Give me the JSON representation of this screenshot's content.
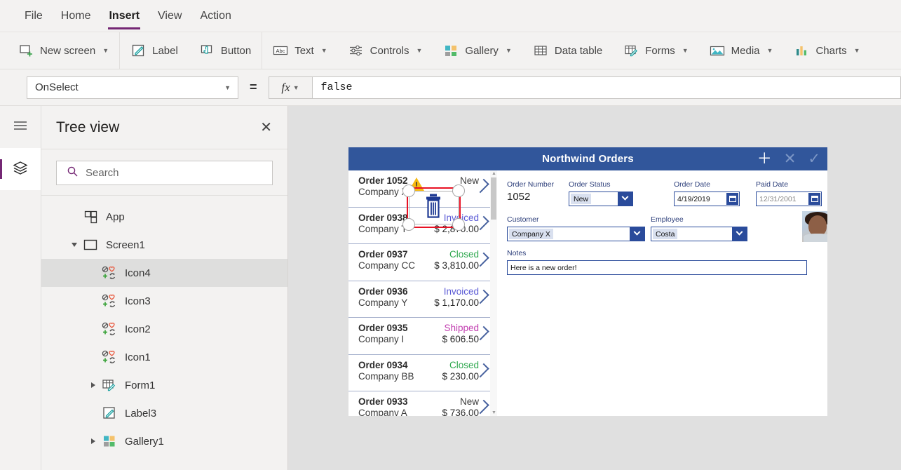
{
  "menubar": {
    "items": [
      {
        "label": "File",
        "active": false
      },
      {
        "label": "Home",
        "active": false
      },
      {
        "label": "Insert",
        "active": true
      },
      {
        "label": "View",
        "active": false
      },
      {
        "label": "Action",
        "active": false
      }
    ]
  },
  "ribbon": {
    "items": [
      {
        "label": "New screen",
        "icon": "new-screen-icon",
        "caret": true
      },
      {
        "label": "Label",
        "icon": "label-icon",
        "caret": false
      },
      {
        "label": "Button",
        "icon": "button-icon",
        "caret": false
      },
      {
        "label": "Text",
        "icon": "text-abc-icon",
        "caret": true
      },
      {
        "label": "Controls",
        "icon": "controls-sliders-icon",
        "caret": true
      },
      {
        "label": "Gallery",
        "icon": "gallery-squares-icon",
        "caret": true
      },
      {
        "label": "Data table",
        "icon": "data-table-icon",
        "caret": false
      },
      {
        "label": "Forms",
        "icon": "forms-icon",
        "caret": true
      },
      {
        "label": "Media",
        "icon": "media-image-icon",
        "caret": true
      },
      {
        "label": "Charts",
        "icon": "charts-bar-icon",
        "caret": true
      }
    ]
  },
  "formula_bar": {
    "property": "OnSelect",
    "equals": "=",
    "fx_label": "fx",
    "value": "false"
  },
  "rail": {
    "menu_icon": "hamburger-menu-icon",
    "tree_icon": "layers-tree-icon",
    "accent_color": "#742774"
  },
  "tree_panel": {
    "title": "Tree view",
    "close_label": "✕",
    "search_placeholder": "Search",
    "items": [
      {
        "label": "App",
        "indent": 1,
        "icon": "app-icon",
        "twisty": "none",
        "selected": false
      },
      {
        "label": "Screen1",
        "indent": 1,
        "icon": "screen-icon",
        "twisty": "open",
        "selected": false
      },
      {
        "label": "Icon4",
        "indent": 2,
        "icon": "icon-set-icon",
        "twisty": "none",
        "selected": true
      },
      {
        "label": "Icon3",
        "indent": 2,
        "icon": "icon-set-icon",
        "twisty": "none",
        "selected": false
      },
      {
        "label": "Icon2",
        "indent": 2,
        "icon": "icon-set-icon",
        "twisty": "none",
        "selected": false
      },
      {
        "label": "Icon1",
        "indent": 2,
        "icon": "icon-set-icon",
        "twisty": "none",
        "selected": false
      },
      {
        "label": "Form1",
        "indent": 2,
        "icon": "form-icon",
        "twisty": "closed",
        "selected": false
      },
      {
        "label": "Label3",
        "indent": 2,
        "icon": "label-icon",
        "twisty": "none",
        "selected": false
      },
      {
        "label": "Gallery1",
        "indent": 2,
        "icon": "gallery-icon",
        "twisty": "closed",
        "selected": false
      }
    ]
  },
  "app": {
    "header": {
      "title": "Northwind Orders",
      "actions": [
        {
          "name": "add-icon",
          "glyph": "＋",
          "dim": false
        },
        {
          "name": "cancel-icon",
          "glyph": "✕",
          "dim": true
        },
        {
          "name": "save-icon",
          "glyph": "✓",
          "dim": true
        }
      ]
    },
    "gallery": {
      "rows": [
        {
          "order": "Order 1052",
          "company": "Company X",
          "status": "New",
          "amount": "",
          "status_color": "#3b3b3b",
          "warning": true
        },
        {
          "order": "Order 0938",
          "company": "Company T",
          "status": "Invoiced",
          "amount": "$ 2,870.00",
          "status_color": "#5b5bd6",
          "warning": false
        },
        {
          "order": "Order 0937",
          "company": "Company CC",
          "status": "Closed",
          "amount": "$ 3,810.00",
          "status_color": "#2fa84f",
          "warning": false
        },
        {
          "order": "Order 0936",
          "company": "Company Y",
          "status": "Invoiced",
          "amount": "$ 1,170.00",
          "status_color": "#5b5bd6",
          "warning": false
        },
        {
          "order": "Order 0935",
          "company": "Company I",
          "status": "Shipped",
          "amount": "$ 606.50",
          "status_color": "#c23fb0",
          "warning": false
        },
        {
          "order": "Order 0934",
          "company": "Company BB",
          "status": "Closed",
          "amount": "$ 230.00",
          "status_color": "#2fa84f",
          "warning": false
        },
        {
          "order": "Order 0933",
          "company": "Company A",
          "status": "New",
          "amount": "$ 736.00",
          "status_color": "#3b3b3b",
          "warning": false
        }
      ]
    },
    "form": {
      "order_number_label": "Order Number",
      "order_number_value": "1052",
      "order_status_label": "Order Status",
      "order_status_value": "New",
      "order_date_label": "Order Date",
      "order_date_value": "4/19/2019",
      "paid_date_label": "Paid Date",
      "paid_date_value": "12/31/2001",
      "customer_label": "Customer",
      "customer_value": "Company X",
      "employee_label": "Employee",
      "employee_value": "Costa",
      "notes_label": "Notes",
      "notes_value": "Here is a new order!"
    },
    "selection": {
      "selected_control_icon": "trash-delete-icon",
      "handle_count": 4,
      "border_color": "#e81123"
    }
  }
}
